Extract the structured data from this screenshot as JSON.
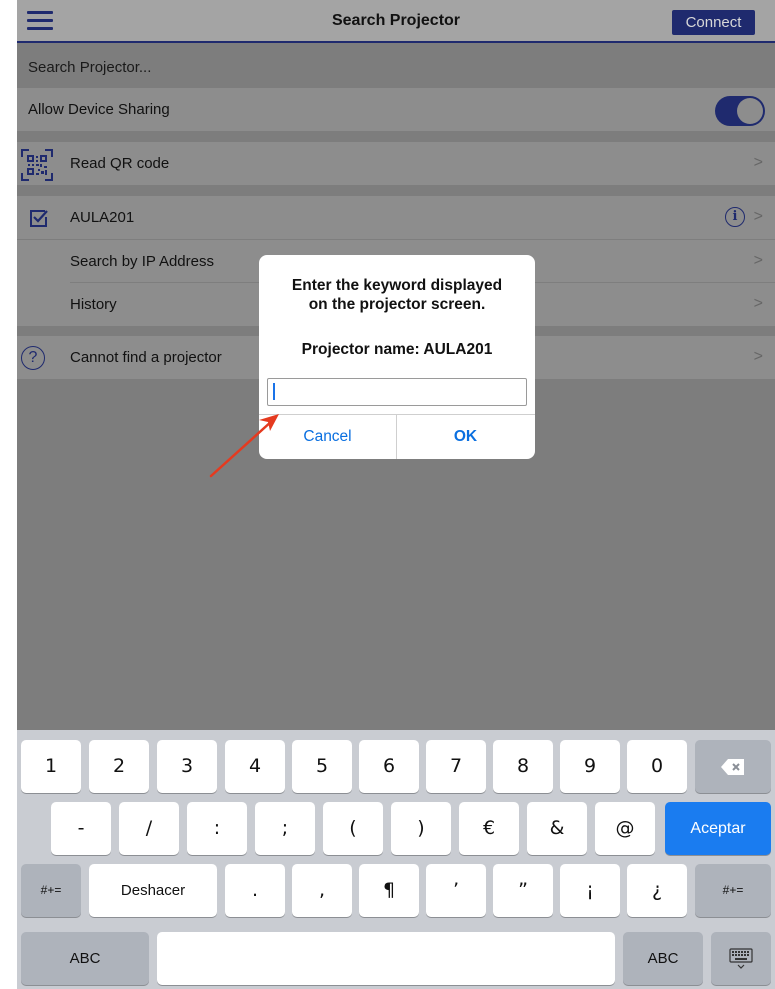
{
  "navbar": {
    "title": "Search Projector",
    "connect_label": "Connect",
    "icons": {
      "menu": "hamburger-menu-icon"
    }
  },
  "list": {
    "section_search": "Search Projector...",
    "allow_sharing": "Allow Device Sharing",
    "allow_sharing_on": true,
    "read_qr": "Read QR code",
    "projector": "AULA201",
    "search_ip": "Search by IP Address",
    "history": "History",
    "cannot_find": "Cannot find a projector",
    "chevron": ">",
    "info_glyph": "i",
    "help_glyph": "?"
  },
  "dialog": {
    "message_line1": "Enter the keyword displayed",
    "message_line2": "on the projector screen.",
    "projector_name": "Projector name: AULA201",
    "input_value": "",
    "cancel_label": "Cancel",
    "ok_label": "OK"
  },
  "keyboard": {
    "row1": [
      "1",
      "2",
      "3",
      "4",
      "5",
      "6",
      "7",
      "8",
      "9",
      "0"
    ],
    "row2": [
      "-",
      "/",
      ":",
      ";",
      "(",
      ")",
      "€",
      "&",
      "@"
    ],
    "return_label": "Aceptar",
    "shift_label": "#+=",
    "undo_label": "Deshacer",
    "row3": [
      ".",
      ",",
      "¶",
      "’",
      "”",
      "¡",
      "¿"
    ],
    "abc_label": "ABC",
    "icons": {
      "backspace": "backspace-icon",
      "hide_keyboard": "keyboard-hide-icon"
    }
  },
  "colors": {
    "accent": "#1f2a6e",
    "link_blue": "#0a6fe0",
    "return_key": "#1a7cf0",
    "arrow": "#e53a1f"
  }
}
